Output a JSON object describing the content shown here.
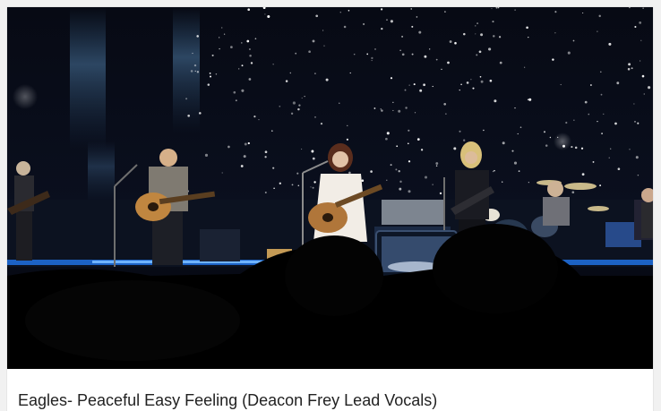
{
  "video": {
    "title": "Eagles- Peaceful Easy Feeling (Deacon Frey Lead Vocals)",
    "thumbnail_description_icon": "concert-stage-image"
  },
  "colors": {
    "background": "#f1f1f1",
    "title_text": "#222222",
    "stage_blue": "#1e6bd6",
    "night_sky": "#05070d"
  }
}
